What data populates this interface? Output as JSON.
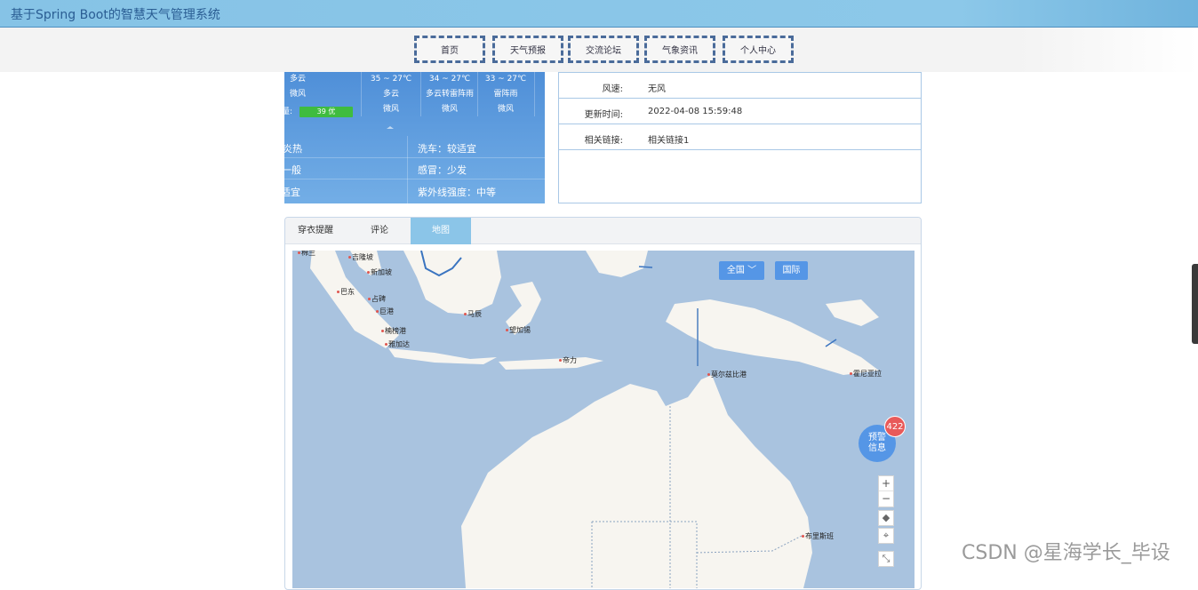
{
  "app": {
    "title": "基于Spring Boot的智慧天气管理系统"
  },
  "nav": [
    {
      "label": "首页"
    },
    {
      "label": "天气预报"
    },
    {
      "label": "交流论坛"
    },
    {
      "label": "气象资讯"
    },
    {
      "label": "个人中心"
    }
  ],
  "weather": {
    "today": {
      "desc": "多云",
      "wind": "微风",
      "aqi_label": "量:",
      "aqi": "39 优"
    },
    "forecast": [
      {
        "temp": "35 ~ 27℃",
        "desc": "多云",
        "wind": "微风"
      },
      {
        "temp": "34 ~ 27℃",
        "desc": "多云转雷阵雨",
        "wind": "微风"
      },
      {
        "temp": "33 ~ 27℃",
        "desc": "雷阵雨",
        "wind": "微风"
      }
    ],
    "tips_left": [
      "炎热",
      "一般",
      "适宜"
    ],
    "tips_right": [
      "洗车：较适宜",
      "感冒：少发",
      "紫外线强度：中等"
    ]
  },
  "info": {
    "rows": [
      {
        "key": "风速:",
        "value": "无风"
      },
      {
        "key": "更新时间:",
        "value": "2022-04-08 15:59:48"
      },
      {
        "key": "相关链接:",
        "value": "相关链接1"
      }
    ]
  },
  "tabs": [
    {
      "label": "穿衣提醒",
      "active": false
    },
    {
      "label": "评论",
      "active": false
    },
    {
      "label": "地图",
      "active": true
    }
  ],
  "map": {
    "btn_national": "全国 ﹀",
    "btn_international": "国际",
    "alert_line1": "预警",
    "alert_line2": "信息",
    "alert_count": "422",
    "zoom_in": "+",
    "zoom_out": "−",
    "cities": [
      {
        "name": "棉兰"
      },
      {
        "name": "吉隆坡"
      },
      {
        "name": "新加坡"
      },
      {
        "name": "巴东"
      },
      {
        "name": "占碑"
      },
      {
        "name": "巨港"
      },
      {
        "name": "楠榜港"
      },
      {
        "name": "雅加达"
      },
      {
        "name": "马辰"
      },
      {
        "name": "望加锡"
      },
      {
        "name": "帝力"
      },
      {
        "name": "莫尔兹比港"
      },
      {
        "name": "霍尼亚拉"
      },
      {
        "name": "布里斯班"
      }
    ]
  },
  "watermark": "CSDN @星海学长_毕设"
}
